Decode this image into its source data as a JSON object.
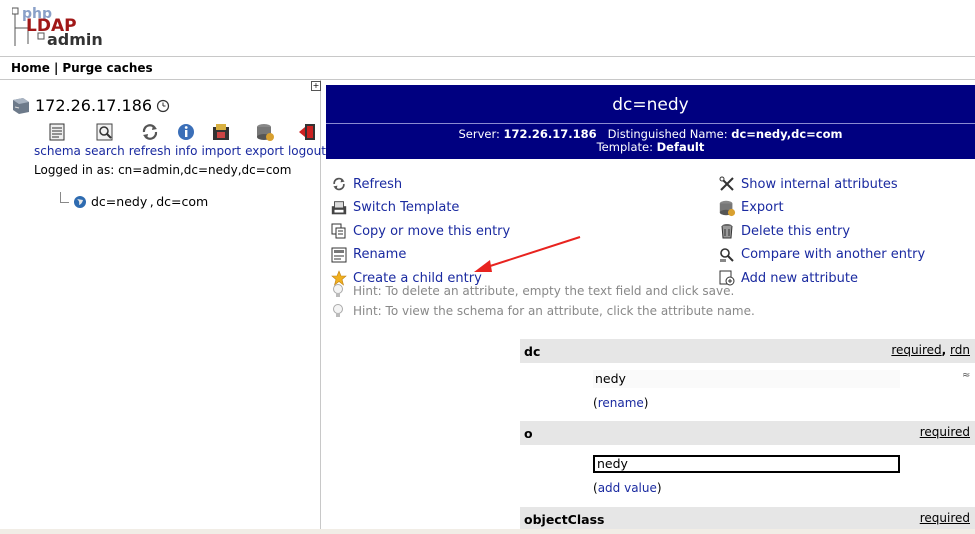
{
  "logo": {
    "line1": "php",
    "line2": "LDAP",
    "line3": "admin"
  },
  "topnav": {
    "home": "Home",
    "separator": "|",
    "purge": "Purge caches"
  },
  "left": {
    "expand_glyph": "+",
    "server_name": "172.26.17.186",
    "tools": [
      {
        "label": "schema",
        "icon": "schema-icon"
      },
      {
        "label": "search",
        "icon": "search-icon"
      },
      {
        "label": "refresh",
        "icon": "refresh-icon"
      },
      {
        "label": "info",
        "icon": "info-icon"
      },
      {
        "label": "import",
        "icon": "import-icon"
      },
      {
        "label": "export",
        "icon": "export-icon"
      },
      {
        "label": "logout",
        "icon": "logout-icon"
      }
    ],
    "logged_in": "Logged in as: cn=admin,dc=nedy,dc=com",
    "tree_entry": "dc=nedy , dc=com"
  },
  "header": {
    "dn": "dc=nedy",
    "server_label": "Server:",
    "server_value": "172.26.17.186",
    "dn_label": "Distinguished Name:",
    "dn_value": "dc=nedy,dc=com",
    "template_label": "Template:",
    "template_value": "Default"
  },
  "actions_left": [
    {
      "label": "Refresh",
      "icon": "refresh-icon"
    },
    {
      "label": "Switch Template",
      "icon": "switch-template-icon"
    },
    {
      "label": "Copy or move this entry",
      "icon": "copy-icon"
    },
    {
      "label": "Rename",
      "icon": "rename-icon"
    },
    {
      "label": "Create a child entry",
      "icon": "star-icon"
    }
  ],
  "actions_right": [
    {
      "label": "Show internal attributes",
      "icon": "tools-icon"
    },
    {
      "label": "Export",
      "icon": "export-icon"
    },
    {
      "label": "Delete this entry",
      "icon": "trash-icon"
    },
    {
      "label": "Compare with another entry",
      "icon": "compare-icon"
    },
    {
      "label": "Add new attribute",
      "icon": "add-attribute-icon"
    }
  ],
  "hints": [
    "Hint: To delete an attribute, empty the text field and click save.",
    "Hint: To view the schema for an attribute, click the attribute name."
  ],
  "attributes": {
    "dc": {
      "name": "dc",
      "required": "required",
      "comma": ",",
      "rdn": "rdn",
      "value": "nedy",
      "link_open": "(",
      "link": "rename",
      "link_close": ")",
      "marker": "≈"
    },
    "o": {
      "name": "o",
      "required": "required",
      "value": "nedy",
      "link_open": "(",
      "link": "add value",
      "link_close": ")"
    },
    "objectClass": {
      "name": "objectClass",
      "required": "required"
    }
  },
  "colors": {
    "header_bg": "#000080",
    "link": "#1a2aa0",
    "attr_head_bg": "#e6e6e6",
    "arrow": "#e8231f"
  }
}
